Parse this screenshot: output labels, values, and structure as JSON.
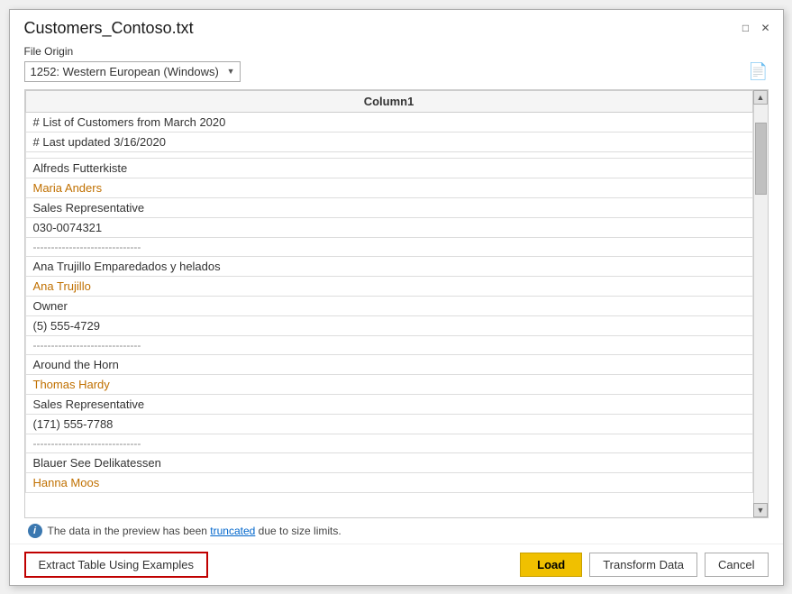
{
  "dialog": {
    "title": "Customers_Contoso.txt",
    "minimize_icon": "□",
    "close_icon": "✕"
  },
  "file_origin": {
    "label": "File Origin",
    "options": [
      "1252: Western European (Windows)"
    ],
    "selected": "1252: Western European (Windows)"
  },
  "file_icon": "📄",
  "table": {
    "column_header": "Column1",
    "rows": [
      {
        "text": "# List of Customers from March 2020",
        "type": "normal"
      },
      {
        "text": "# Last updated 3/16/2020",
        "type": "normal"
      },
      {
        "text": "",
        "type": "normal"
      },
      {
        "text": "Alfreds Futterkiste",
        "type": "normal"
      },
      {
        "text": "Maria Anders",
        "type": "link"
      },
      {
        "text": "Sales Representative",
        "type": "normal"
      },
      {
        "text": "030-0074321",
        "type": "normal"
      },
      {
        "text": "------------------------------",
        "type": "separator"
      },
      {
        "text": "Ana Trujillo Emparedados y helados",
        "type": "normal"
      },
      {
        "text": "Ana Trujillo",
        "type": "link"
      },
      {
        "text": "Owner",
        "type": "normal"
      },
      {
        "text": "(5) 555-4729",
        "type": "normal"
      },
      {
        "text": "------------------------------",
        "type": "separator"
      },
      {
        "text": "Around the Horn",
        "type": "normal"
      },
      {
        "text": "Thomas Hardy",
        "type": "link"
      },
      {
        "text": "Sales Representative",
        "type": "normal"
      },
      {
        "text": "(171) 555-7788",
        "type": "normal"
      },
      {
        "text": "------------------------------",
        "type": "separator"
      },
      {
        "text": "Blauer See Delikatessen",
        "type": "normal"
      },
      {
        "text": "Hanna Moos",
        "type": "link"
      }
    ]
  },
  "truncation_notice": {
    "text_before": "The data in the preview has been ",
    "link_text": "truncated",
    "text_after": " due to size limits."
  },
  "footer": {
    "extract_btn_label": "Extract Table Using Examples",
    "load_btn_label": "Load",
    "transform_btn_label": "Transform Data",
    "cancel_btn_label": "Cancel"
  }
}
